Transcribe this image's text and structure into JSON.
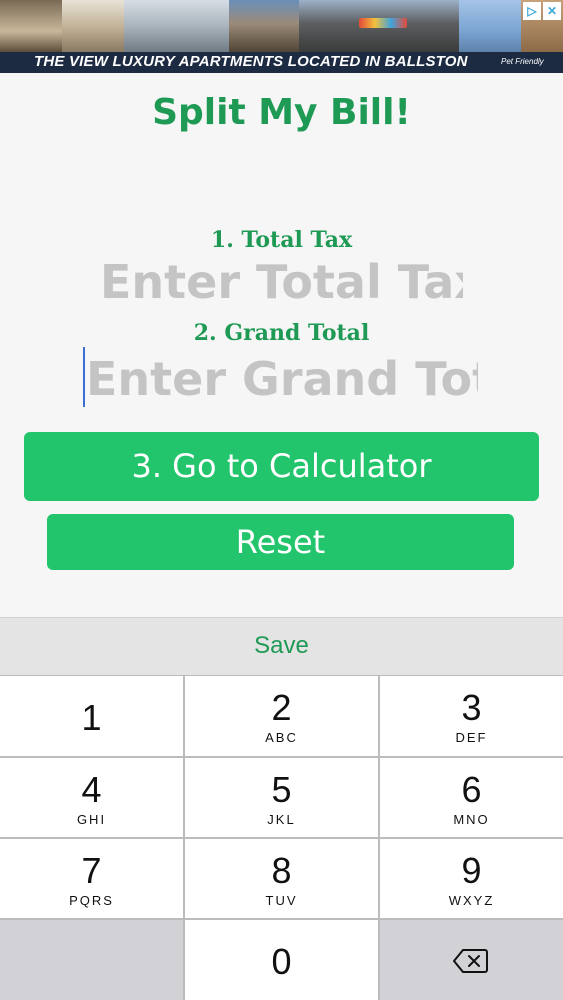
{
  "ad": {
    "headline": "THE VIEW LUXURY APARTMENTS LOCATED IN BALLSTON",
    "tagline": "Pet Friendly",
    "info_glyph": "▷",
    "close_glyph": "✕"
  },
  "app": {
    "title": "Split My Bill!",
    "fields": [
      {
        "label": "1. Total Tax",
        "placeholder": "Enter Total Tax",
        "value": ""
      },
      {
        "label": "2. Grand Total",
        "placeholder": "Enter Grand Total",
        "value": ""
      }
    ],
    "buttons": {
      "calculator": "3. Go to Calculator",
      "reset": "Reset"
    },
    "accent_color": "#1f9a55",
    "button_color": "#22c56b"
  },
  "keyboard": {
    "toolbar_label": "Save",
    "keys": [
      {
        "num": "1",
        "letters": ""
      },
      {
        "num": "2",
        "letters": "ABC"
      },
      {
        "num": "3",
        "letters": "DEF"
      },
      {
        "num": "4",
        "letters": "GHI"
      },
      {
        "num": "5",
        "letters": "JKL"
      },
      {
        "num": "6",
        "letters": "MNO"
      },
      {
        "num": "7",
        "letters": "PQRS"
      },
      {
        "num": "8",
        "letters": "TUV"
      },
      {
        "num": "9",
        "letters": "WXYZ"
      },
      {
        "num": "0",
        "letters": ""
      }
    ],
    "delete_icon": "backspace-icon"
  }
}
